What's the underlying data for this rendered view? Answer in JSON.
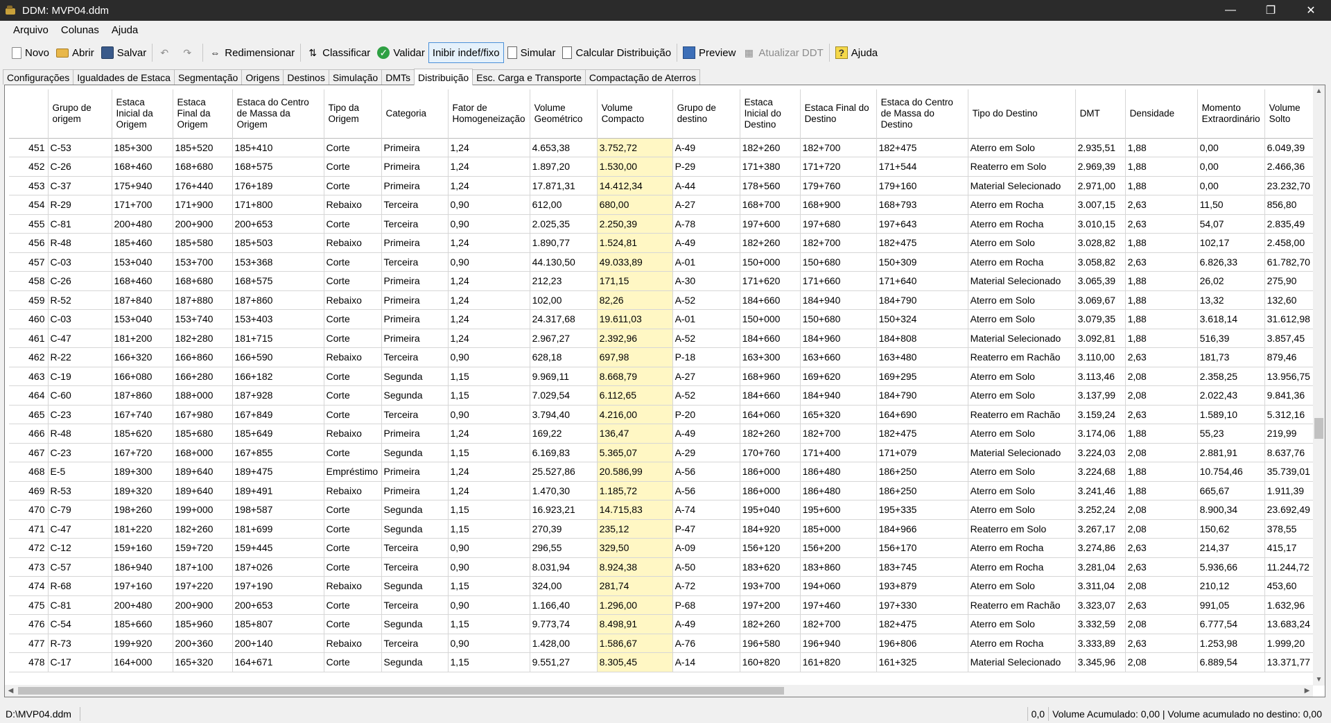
{
  "window": {
    "title": "DDM: MVP04.ddm"
  },
  "menu": [
    "Arquivo",
    "Colunas",
    "Ajuda"
  ],
  "toolbar": {
    "novo": "Novo",
    "abrir": "Abrir",
    "salvar": "Salvar",
    "redimensionar": "Redimensionar",
    "classificar": "Classificar",
    "validar": "Validar",
    "inibir": "Inibir indef/fixo",
    "simular": "Simular",
    "calcular": "Calcular Distribuição",
    "preview": "Preview",
    "atualizar": "Atualizar DDT",
    "ajuda": "Ajuda"
  },
  "tabs": [
    "Configurações",
    "Igualdades de Estaca",
    "Segmentação",
    "Origens",
    "Destinos",
    "Simulação",
    "DMTs",
    "Distribuição",
    "Esc. Carga e Transporte",
    "Compactação de Aterros"
  ],
  "active_tab": "Distribuição",
  "columns": [
    "",
    "Grupo de origem",
    "Estaca Inicial da Origem",
    "Estaca Final da Origem",
    "Estaca do Centro de Massa da Origem",
    "Tipo da Origem",
    "Categoria",
    "Fator de Homogeneização",
    "Volume Geométrico",
    "Volume Compacto",
    "Grupo de destino",
    "Estaca Inicial do Destino",
    "Estaca Final do Destino",
    "Estaca do Centro de Massa do Destino",
    "Tipo do Destino",
    "DMT",
    "Densidade",
    "Momento Extraordinário",
    "Volume Solto"
  ],
  "rows": [
    [
      "451",
      "C-53",
      "185+300",
      "185+520",
      "185+410",
      "Corte",
      "Primeira",
      "1,24",
      "4.653,38",
      "3.752,72",
      "A-49",
      "182+260",
      "182+700",
      "182+475",
      "Aterro em Solo",
      "2.935,51",
      "1,88",
      "0,00",
      "6.049,39"
    ],
    [
      "452",
      "C-26",
      "168+460",
      "168+680",
      "168+575",
      "Corte",
      "Primeira",
      "1,24",
      "1.897,20",
      "1.530,00",
      "P-29",
      "171+380",
      "171+720",
      "171+544",
      "Reaterro em Solo",
      "2.969,39",
      "1,88",
      "0,00",
      "2.466,36"
    ],
    [
      "453",
      "C-37",
      "175+940",
      "176+440",
      "176+189",
      "Corte",
      "Primeira",
      "1,24",
      "17.871,31",
      "14.412,34",
      "A-44",
      "178+560",
      "179+760",
      "179+160",
      "Material Selecionado",
      "2.971,00",
      "1,88",
      "0,00",
      "23.232,70"
    ],
    [
      "454",
      "R-29",
      "171+700",
      "171+900",
      "171+800",
      "Rebaixo",
      "Terceira",
      "0,90",
      "612,00",
      "680,00",
      "A-27",
      "168+700",
      "168+900",
      "168+793",
      "Aterro em Rocha",
      "3.007,15",
      "2,63",
      "11,50",
      "856,80"
    ],
    [
      "455",
      "C-81",
      "200+480",
      "200+900",
      "200+653",
      "Corte",
      "Terceira",
      "0,90",
      "2.025,35",
      "2.250,39",
      "A-78",
      "197+600",
      "197+680",
      "197+643",
      "Aterro em Rocha",
      "3.010,15",
      "2,63",
      "54,07",
      "2.835,49"
    ],
    [
      "456",
      "R-48",
      "185+460",
      "185+580",
      "185+503",
      "Rebaixo",
      "Primeira",
      "1,24",
      "1.890,77",
      "1.524,81",
      "A-49",
      "182+260",
      "182+700",
      "182+475",
      "Aterro em Solo",
      "3.028,82",
      "1,88",
      "102,17",
      "2.458,00"
    ],
    [
      "457",
      "C-03",
      "153+040",
      "153+700",
      "153+368",
      "Corte",
      "Terceira",
      "0,90",
      "44.130,50",
      "49.033,89",
      "A-01",
      "150+000",
      "150+680",
      "150+309",
      "Aterro em Rocha",
      "3.058,82",
      "2,63",
      "6.826,33",
      "61.782,70"
    ],
    [
      "458",
      "C-26",
      "168+460",
      "168+680",
      "168+575",
      "Corte",
      "Primeira",
      "1,24",
      "212,23",
      "171,15",
      "A-30",
      "171+620",
      "171+660",
      "171+640",
      "Material Selecionado",
      "3.065,39",
      "1,88",
      "26,02",
      "275,90"
    ],
    [
      "459",
      "R-52",
      "187+840",
      "187+880",
      "187+860",
      "Rebaixo",
      "Primeira",
      "1,24",
      "102,00",
      "82,26",
      "A-52",
      "184+660",
      "184+940",
      "184+790",
      "Aterro em Solo",
      "3.069,67",
      "1,88",
      "13,32",
      "132,60"
    ],
    [
      "460",
      "C-03",
      "153+040",
      "153+740",
      "153+403",
      "Corte",
      "Primeira",
      "1,24",
      "24.317,68",
      "19.611,03",
      "A-01",
      "150+000",
      "150+680",
      "150+324",
      "Aterro em Solo",
      "3.079,35",
      "1,88",
      "3.618,14",
      "31.612,98"
    ],
    [
      "461",
      "C-47",
      "181+200",
      "182+280",
      "181+715",
      "Corte",
      "Primeira",
      "1,24",
      "2.967,27",
      "2.392,96",
      "A-52",
      "184+660",
      "184+960",
      "184+808",
      "Material Selecionado",
      "3.092,81",
      "1,88",
      "516,39",
      "3.857,45"
    ],
    [
      "462",
      "R-22",
      "166+320",
      "166+860",
      "166+590",
      "Rebaixo",
      "Terceira",
      "0,90",
      "628,18",
      "697,98",
      "P-18",
      "163+300",
      "163+660",
      "163+480",
      "Reaterro em Rachão",
      "3.110,00",
      "2,63",
      "181,73",
      "879,46"
    ],
    [
      "463",
      "C-19",
      "166+080",
      "166+280",
      "166+182",
      "Corte",
      "Segunda",
      "1,15",
      "9.969,11",
      "8.668,79",
      "A-27",
      "168+960",
      "169+620",
      "169+295",
      "Aterro em Solo",
      "3.113,46",
      "2,08",
      "2.358,25",
      "13.956,75"
    ],
    [
      "464",
      "C-60",
      "187+860",
      "188+000",
      "187+928",
      "Corte",
      "Segunda",
      "1,15",
      "7.029,54",
      "6.112,65",
      "A-52",
      "184+660",
      "184+940",
      "184+790",
      "Aterro em Solo",
      "3.137,99",
      "2,08",
      "2.022,43",
      "9.841,36"
    ],
    [
      "465",
      "C-23",
      "167+740",
      "167+980",
      "167+849",
      "Corte",
      "Terceira",
      "0,90",
      "3.794,40",
      "4.216,00",
      "P-20",
      "164+060",
      "165+320",
      "164+690",
      "Reaterro em Rachão",
      "3.159,24",
      "2,63",
      "1.589,10",
      "5.312,16"
    ],
    [
      "466",
      "R-48",
      "185+620",
      "185+680",
      "185+649",
      "Rebaixo",
      "Primeira",
      "1,24",
      "169,22",
      "136,47",
      "A-49",
      "182+260",
      "182+700",
      "182+475",
      "Aterro em Solo",
      "3.174,06",
      "1,88",
      "55,23",
      "219,99"
    ],
    [
      "467",
      "C-23",
      "167+720",
      "168+000",
      "167+855",
      "Corte",
      "Segunda",
      "1,15",
      "6.169,83",
      "5.365,07",
      "A-29",
      "170+760",
      "171+400",
      "171+079",
      "Material Selecionado",
      "3.224,03",
      "2,08",
      "2.881,91",
      "8.637,76"
    ],
    [
      "468",
      "E-5",
      "189+300",
      "189+640",
      "189+475",
      "Empréstimo",
      "Primeira",
      "1,24",
      "25.527,86",
      "20.586,99",
      "A-56",
      "186+000",
      "186+480",
      "186+250",
      "Aterro em Solo",
      "3.224,68",
      "1,88",
      "10.754,46",
      "35.739,01"
    ],
    [
      "469",
      "R-53",
      "189+320",
      "189+640",
      "189+491",
      "Rebaixo",
      "Primeira",
      "1,24",
      "1.470,30",
      "1.185,72",
      "A-56",
      "186+000",
      "186+480",
      "186+250",
      "Aterro em Solo",
      "3.241,46",
      "1,88",
      "665,67",
      "1.911,39"
    ],
    [
      "470",
      "C-79",
      "198+260",
      "199+000",
      "198+587",
      "Corte",
      "Segunda",
      "1,15",
      "16.923,21",
      "14.715,83",
      "A-74",
      "195+040",
      "195+600",
      "195+335",
      "Aterro em Solo",
      "3.252,24",
      "2,08",
      "8.900,34",
      "23.692,49"
    ],
    [
      "471",
      "C-47",
      "181+220",
      "182+260",
      "181+699",
      "Corte",
      "Segunda",
      "1,15",
      "270,39",
      "235,12",
      "P-47",
      "184+920",
      "185+000",
      "184+966",
      "Reaterro em Solo",
      "3.267,17",
      "2,08",
      "150,62",
      "378,55"
    ],
    [
      "472",
      "C-12",
      "159+160",
      "159+720",
      "159+445",
      "Corte",
      "Terceira",
      "0,90",
      "296,55",
      "329,50",
      "A-09",
      "156+120",
      "156+200",
      "156+170",
      "Aterro em Rocha",
      "3.274,86",
      "2,63",
      "214,37",
      "415,17"
    ],
    [
      "473",
      "C-57",
      "186+940",
      "187+100",
      "187+026",
      "Corte",
      "Terceira",
      "0,90",
      "8.031,94",
      "8.924,38",
      "A-50",
      "183+620",
      "183+860",
      "183+745",
      "Aterro em Rocha",
      "3.281,04",
      "2,63",
      "5.936,66",
      "11.244,72"
    ],
    [
      "474",
      "R-68",
      "197+160",
      "197+220",
      "197+190",
      "Rebaixo",
      "Segunda",
      "1,15",
      "324,00",
      "281,74",
      "A-72",
      "193+700",
      "194+060",
      "193+879",
      "Aterro em Solo",
      "3.311,04",
      "2,08",
      "210,12",
      "453,60"
    ],
    [
      "475",
      "C-81",
      "200+480",
      "200+900",
      "200+653",
      "Corte",
      "Terceira",
      "0,90",
      "1.166,40",
      "1.296,00",
      "P-68",
      "197+200",
      "197+460",
      "197+330",
      "Reaterro em Rachão",
      "3.323,07",
      "2,63",
      "991,05",
      "1.632,96"
    ],
    [
      "476",
      "C-54",
      "185+660",
      "185+960",
      "185+807",
      "Corte",
      "Segunda",
      "1,15",
      "9.773,74",
      "8.498,91",
      "A-49",
      "182+260",
      "182+700",
      "182+475",
      "Aterro em Solo",
      "3.332,59",
      "2,08",
      "6.777,54",
      "13.683,24"
    ],
    [
      "477",
      "R-73",
      "199+920",
      "200+360",
      "200+140",
      "Rebaixo",
      "Terceira",
      "0,90",
      "1.428,00",
      "1.586,67",
      "A-76",
      "196+580",
      "196+940",
      "196+806",
      "Aterro em Rocha",
      "3.333,89",
      "2,63",
      "1.253,98",
      "1.999,20"
    ],
    [
      "478",
      "C-17",
      "164+000",
      "165+320",
      "164+671",
      "Corte",
      "Segunda",
      "1,15",
      "9.551,27",
      "8.305,45",
      "A-14",
      "160+820",
      "161+820",
      "161+325",
      "Material Selecionado",
      "3.345,96",
      "2,08",
      "6.889,54",
      "13.371,77"
    ]
  ],
  "status": {
    "path": "D:\\MVP04.ddm",
    "value": "0,0",
    "volumes": "Volume Acumulado: 0,00 | Volume acumulado no destino: 0,00"
  },
  "colors": {
    "highlight_column": "#fff7c4",
    "titlebar": "#2b2b2b"
  }
}
